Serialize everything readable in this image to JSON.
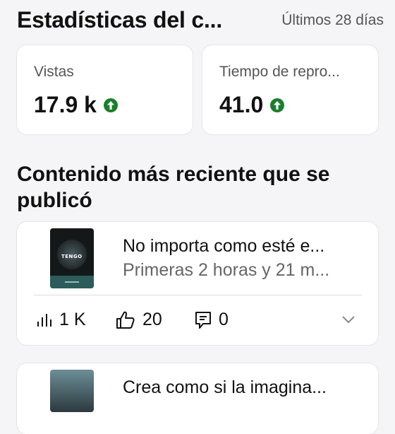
{
  "header": {
    "title": "Estadísticas del c...",
    "period": "Últimos 28 días"
  },
  "stats": [
    {
      "label": "Vistas",
      "value": "17.9 k",
      "trend": "up",
      "trend_icon": "arrow-up-circle-icon"
    },
    {
      "label": "Tiempo de repro...",
      "value": "41.0",
      "trend": "up",
      "trend_icon": "arrow-up-circle-icon"
    }
  ],
  "section": {
    "title": "Contenido más reciente que se publicó"
  },
  "videos": [
    {
      "title": "No importa como esté e...",
      "subtitle": "Primeras 2 horas y 21 m...",
      "thumb_text": "TENGO",
      "metrics": {
        "views": "1 K",
        "likes": "20",
        "comments": "0"
      }
    },
    {
      "title": "Crea como si la imagina..."
    }
  ],
  "colors": {
    "background": "#f5f5f7",
    "card": "#ffffff",
    "trend_up": "#1a7f2c",
    "muted_text": "#666666"
  }
}
